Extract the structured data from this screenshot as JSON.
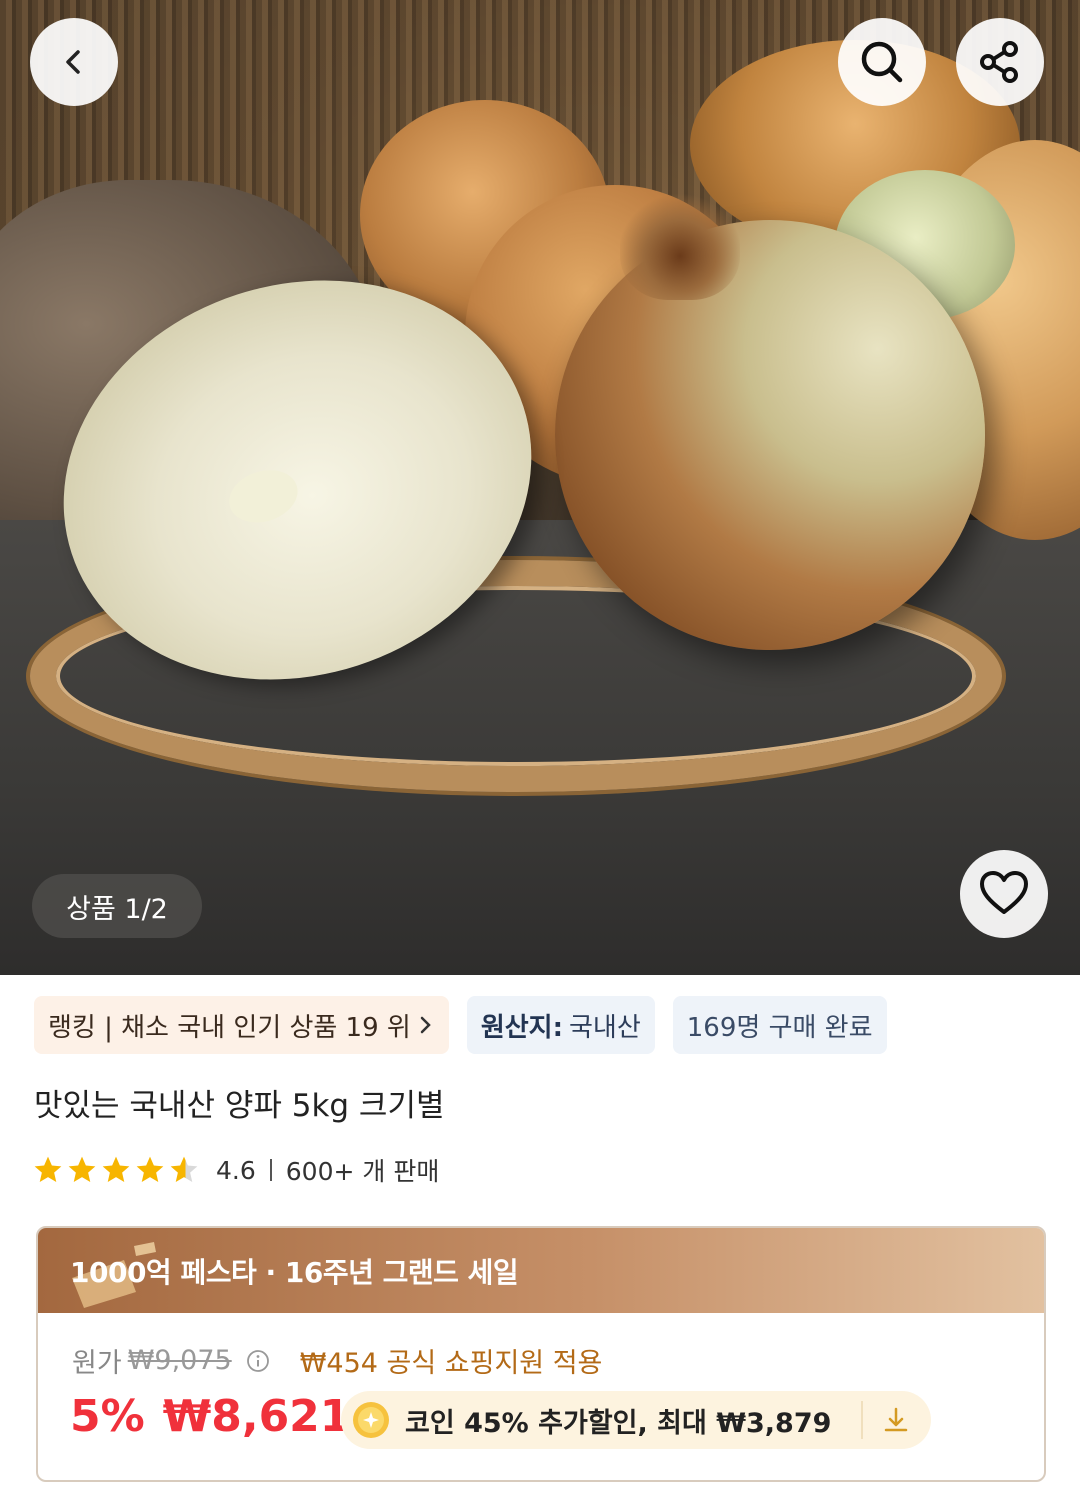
{
  "header": {
    "back_icon": "chevron-left-icon",
    "search_icon": "search-icon",
    "share_icon": "share-icon"
  },
  "gallery": {
    "counter": "상품 1/2",
    "wishlist_icon": "heart-outline-icon"
  },
  "chips": {
    "ranking": "랭킹 | 채소 국내 인기 상품 19 위",
    "origin_label": "원산지:",
    "origin_value": "국내산",
    "purchased": "169명 구매 완료"
  },
  "product": {
    "title": "맛있는 국내산 양파 5kg 크기별",
    "rating": "4.6",
    "rating_value": 4.6,
    "sold": "600+ 개 판매"
  },
  "deal": {
    "banner": "1000억 페스타 · 16주년 그랜드 세일",
    "original_label": "원가",
    "original_price": "₩9,075",
    "support": "₩454 공식 쇼핑지원 적용",
    "discount": "5%",
    "price": "₩8,621",
    "coin_text": "코인 45% 추가할인, 최대 ₩3,879"
  },
  "colors": {
    "accent_red": "#f0313b",
    "support_orange": "#b36a17",
    "banner_brown": "#a3683f",
    "star_yellow": "#f7b500"
  }
}
